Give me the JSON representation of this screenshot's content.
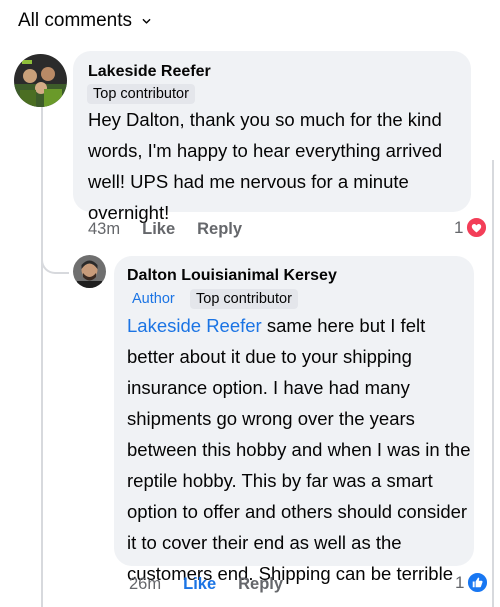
{
  "header": {
    "filter_label": "All comments"
  },
  "comments": [
    {
      "author": "Lakeside Reefer",
      "badges": [
        "Top contributor"
      ],
      "text": "Hey Dalton, thank you so much for the kind words, I'm happy to hear everything arrived well! UPS had me nervous for a minute overnight!",
      "time": "43m",
      "like_label": "Like",
      "reply_label": "Reply",
      "reaction_count": "1",
      "reaction_icon": "heart-icon",
      "reaction_color": "#f33e58"
    },
    {
      "author": "Dalton Louisianimal Kersey",
      "author_tag": "Author",
      "badges": [
        "Top contributor"
      ],
      "mention": "Lakeside Reefer",
      "text": " same here but I felt better about it due to your shipping insurance option. I have had many shipments go wrong over the years between this hobby and when I was in the reptile hobby. This by far was a smart option to offer and others should consider it to cover their end as well as the customers end. Shipping can be terrible",
      "time": "26m",
      "like_label": "Like",
      "reply_label": "Reply",
      "reaction_count": "1",
      "reaction_icon": "like-icon",
      "reaction_color": "#1877f2"
    }
  ]
}
